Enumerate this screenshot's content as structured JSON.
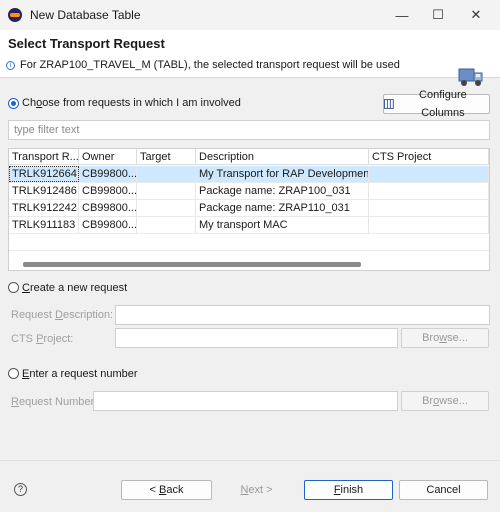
{
  "window": {
    "title": "New Database Table",
    "minimize": "—",
    "maximize": "☐",
    "close": "✕"
  },
  "header": {
    "title": "Select Transport Request",
    "message": "For ZRAP100_TRAVEL_M (TABL), the selected transport request will be used"
  },
  "involved": {
    "label_pre": "Ch",
    "label_u": "o",
    "label_post": "ose from requests in which I am involved",
    "configure_label": "Configure Columns",
    "filter_placeholder": "type filter text"
  },
  "table": {
    "columns": [
      "Transport R...",
      "Owner",
      "Target",
      "Description",
      "CTS Project"
    ],
    "rows": [
      [
        "TRLK912664",
        "CB99800...",
        "",
        "My Transport for RAP Development",
        ""
      ],
      [
        "TRLK912486",
        "CB99800...",
        "",
        "Package name: ZRAP100_031",
        ""
      ],
      [
        "TRLK912242",
        "CB99800...",
        "",
        "Package name: ZRAP110_031",
        ""
      ],
      [
        "TRLK911183",
        "CB99800...",
        "",
        "My transport MAC",
        ""
      ]
    ]
  },
  "create": {
    "label_u": "C",
    "label_post": "reate a new request",
    "desc_pre": "Request ",
    "desc_u": "D",
    "desc_post": "escription: *",
    "cts_pre": "CTS ",
    "cts_u": "P",
    "cts_post": "roject:",
    "browse_pre": "Bro",
    "browse_u": "w",
    "browse_post": "se..."
  },
  "enter": {
    "label_u": "E",
    "label_post": "nter a request number",
    "num_u": "R",
    "num_post": "equest Number:",
    "browse_pre": "Br",
    "browse_u": "o",
    "browse_post": "wse..."
  },
  "footer": {
    "help": "?",
    "back_pre": "< ",
    "back_u": "B",
    "back_post": "ack",
    "next_u": "N",
    "next_post": "ext >",
    "finish_u": "F",
    "finish_post": "inish",
    "cancel": "Cancel"
  }
}
